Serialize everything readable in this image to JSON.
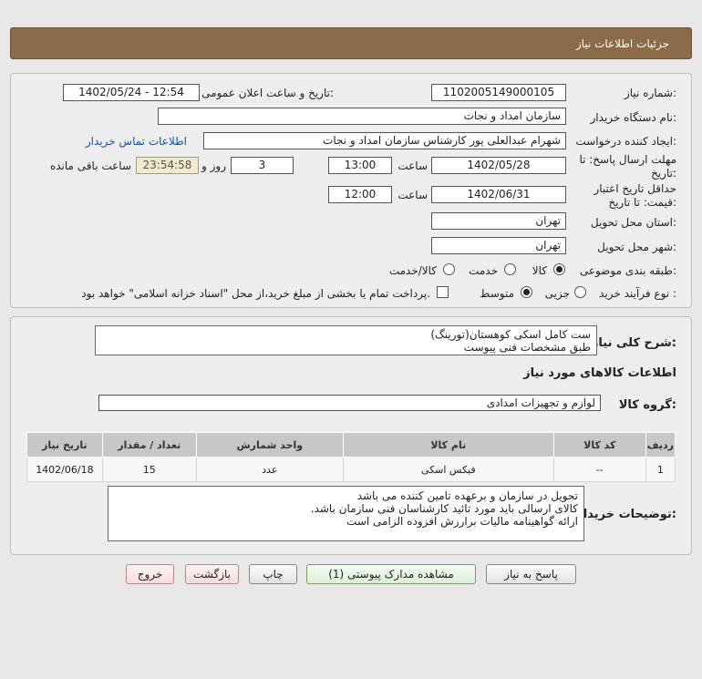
{
  "header": {
    "title": "جزئیات اطلاعات نیاز"
  },
  "form": {
    "need_number": {
      "label": "شماره نیاز:",
      "value": "1102005149000105"
    },
    "announce": {
      "label": "تاریخ و ساعت اعلان عمومی:",
      "value": "1402/05/24 - 12:54"
    },
    "buyer_org": {
      "label": "نام دستگاه خریدار:",
      "value": "سازمان امداد و نجات"
    },
    "requester": {
      "label": "ایجاد کننده درخواست:",
      "value": "شهرام عبدالعلی پور کارشناس   سازمان امداد و نجات",
      "contact_link": "اطلاعات تماس خریدار"
    },
    "reply_deadline": {
      "label_line1": "مهلت ارسال پاسخ: تا",
      "label_line2": "تاریخ:",
      "date": "1402/05/28",
      "time_label": "ساعت",
      "time": "13:00",
      "days": "3",
      "days_label": "روز و",
      "remaining": "23:54:58",
      "remaining_label": "ساعت باقی مانده"
    },
    "price_validity": {
      "label_line1": "حداقل تاریخ اعتبار",
      "label_line2": "قیمت: تا تاریخ:",
      "date": "1402/06/31",
      "time_label": "ساعت",
      "time": "12:00"
    },
    "province": {
      "label": "استان محل تحویل:",
      "value": "تهران"
    },
    "city": {
      "label": "شهر محل تحویل:",
      "value": "تهران"
    },
    "category": {
      "label": "طبقه بندی موضوعی:",
      "options": [
        "کالا",
        "خدمت",
        "کالا/خدمت"
      ],
      "selected": "کالا"
    },
    "process": {
      "label": "نوع فرآیند خرید :",
      "options": [
        "جزیی",
        "متوسط"
      ],
      "selected": "متوسط",
      "checkbox_text": "پرداخت تمام یا بخشی از مبلغ خرید،از محل \"اسناد خزانه اسلامی\" خواهد بود."
    }
  },
  "details": {
    "general_desc_label": "شرح کلی نیاز:",
    "general_desc_lines": [
      "ست کامل اسکی کوهستان(تورینگ)",
      "طبق مشخصات فنی پیوست"
    ],
    "goods_info_title": "اطلاعات کالاهای مورد نیاز",
    "goods_group_label": "گروه کالا:",
    "goods_group_value": "لوازم و تجهیزات امدادی",
    "table": {
      "headers": [
        "ردیف",
        "کد کالا",
        "نام کالا",
        "واحد شمارش",
        "تعداد / مقدار",
        "تاریخ نیاز"
      ],
      "rows": [
        [
          "1",
          "--",
          "فیکس اسکی",
          "عدد",
          "15",
          "1402/06/18"
        ]
      ]
    },
    "buyer_notes_label": "توضیحات خریدار:",
    "buyer_notes_lines": [
      "تحویل در سازمان و برعهده تامین کننده می باشد",
      "کالای ارسالی باید مورد تائید کارشناسان فنی سازمان باشد.",
      "ارائه گواهینامه مالیات برارزش افزوده الزامی است"
    ]
  },
  "buttons": {
    "reply": "پاسخ به نیاز",
    "view_docs": "مشاهده مدارک پیوستی (1)",
    "print": "چاپ",
    "back": "بازگشت",
    "exit": "خروج"
  }
}
